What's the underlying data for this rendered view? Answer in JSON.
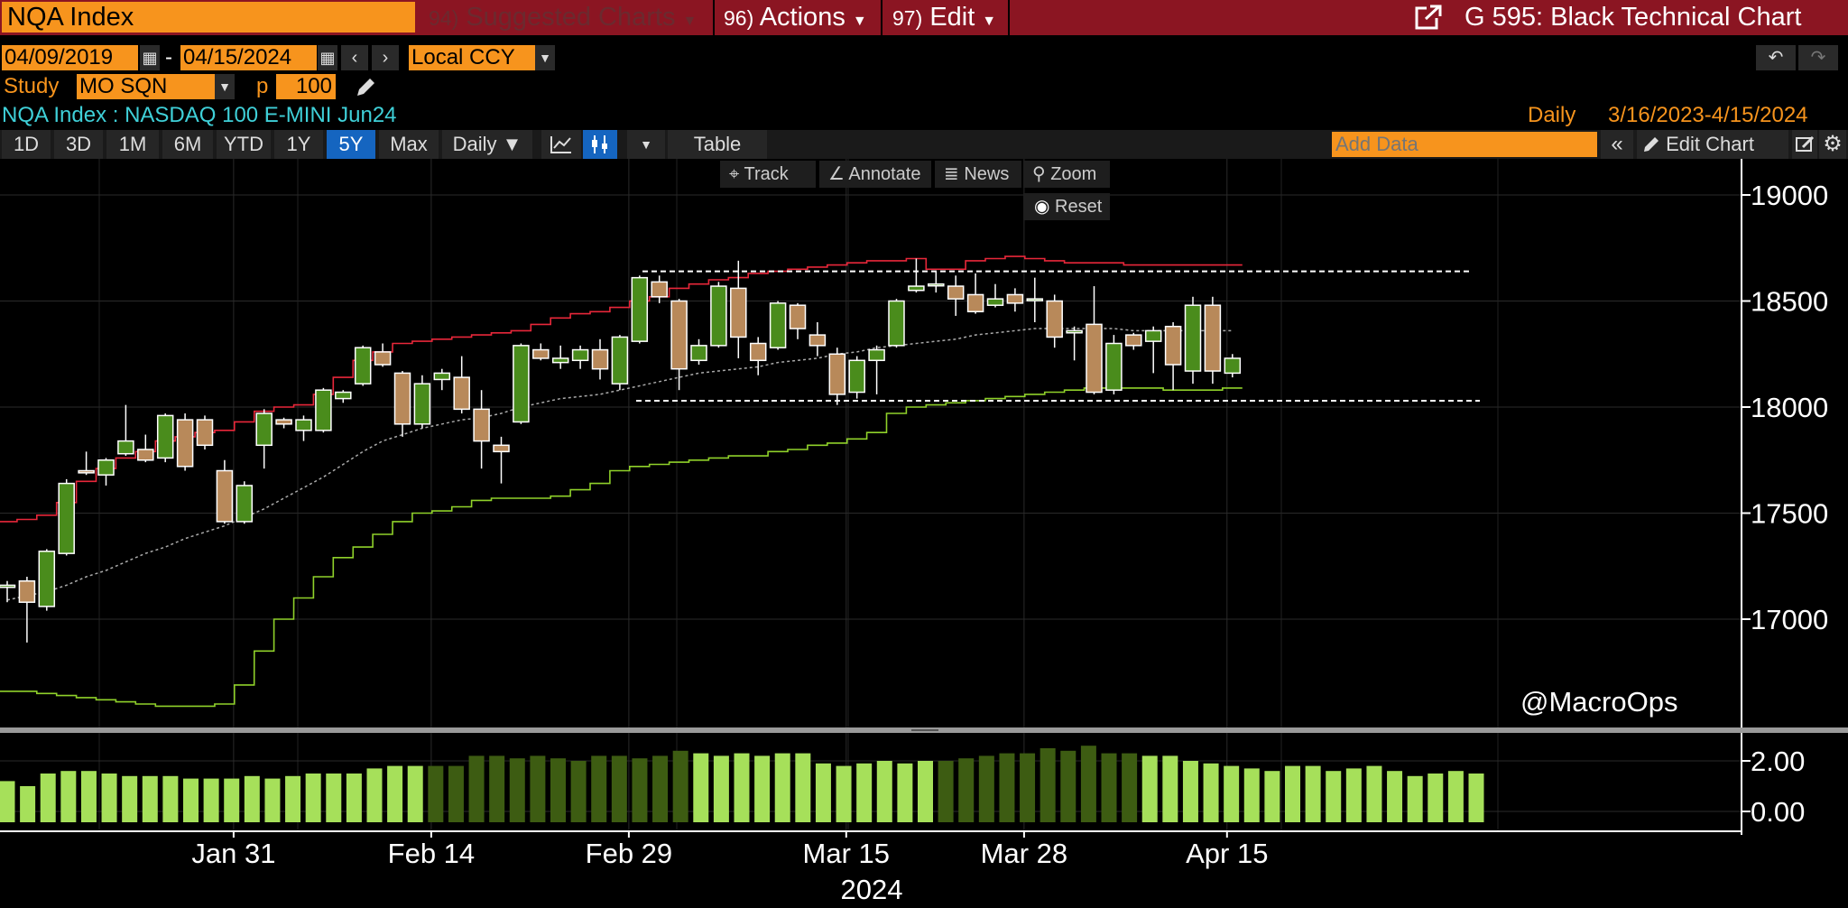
{
  "header": {
    "ticker": "NQA Index",
    "menu": [
      {
        "num": "94)",
        "label": "Suggested Charts",
        "dim": true
      },
      {
        "num": "96)",
        "label": "Actions",
        "dim": false
      },
      {
        "num": "97)",
        "label": "Edit",
        "dim": false
      }
    ],
    "chart_title": "G 595: Black Technical Chart"
  },
  "range": {
    "start": "04/09/2019",
    "dash": "-",
    "end": "04/15/2024",
    "currency": "Local CCY"
  },
  "study": {
    "label": "Study",
    "value": "MO SQN",
    "p_label": "p",
    "p_value": "100"
  },
  "security": {
    "description": "NQA Index : NASDAQ 100 E-MINI Jun24",
    "frequency": "Daily",
    "date_range": "3/16/2023-4/15/2024"
  },
  "toolbar": {
    "periods": [
      "1D",
      "3D",
      "1M",
      "6M",
      "YTD",
      "1Y",
      "5Y",
      "Max"
    ],
    "active_period": "5Y",
    "frequency": "Daily ▼",
    "table_label": "Table",
    "add_data_placeholder": "Add Data",
    "edit_chart_label": "Edit Chart"
  },
  "overlay": {
    "track": "Track",
    "annotate": "Annotate",
    "news": "News",
    "zoom": "Zoom",
    "reset": "Reset"
  },
  "watermark": "@MacroOps",
  "colors": {
    "title_bar": "#8b1522",
    "orange": "#f7941d",
    "up_candle": "#4a8c1c",
    "down_candle": "#b8895a",
    "upper_band": "#e8273a",
    "lower_band": "#8fd12a",
    "ma_line": "#aaaaaa",
    "hist_light": "#a6e05a",
    "hist_dark": "#3d5c12"
  },
  "chart_data": [
    {
      "type": "candlestick",
      "title": "NQA Index : NASDAQ 100 E-MINI Jun24",
      "x_tick_labels": [
        "Jan 31",
        "Feb 14",
        "Feb 29",
        "Mar 15",
        "Mar 28",
        "Apr 15"
      ],
      "x_year_label": "2024",
      "y_ticks": [
        17000,
        17500,
        18000,
        18500,
        19000
      ],
      "ylim": [
        16600,
        19200
      ],
      "candles": [
        {
          "o": 17150,
          "h": 17180,
          "l": 17080,
          "c": 17160
        },
        {
          "o": 17180,
          "h": 17200,
          "l": 16890,
          "c": 17080
        },
        {
          "o": 17060,
          "h": 17330,
          "l": 17040,
          "c": 17320
        },
        {
          "o": 17310,
          "h": 17660,
          "l": 17300,
          "c": 17640
        },
        {
          "o": 17700,
          "h": 17790,
          "l": 17680,
          "c": 17690
        },
        {
          "o": 17680,
          "h": 17760,
          "l": 17630,
          "c": 17750
        },
        {
          "o": 17780,
          "h": 18010,
          "l": 17770,
          "c": 17840
        },
        {
          "o": 17800,
          "h": 17870,
          "l": 17740,
          "c": 17750
        },
        {
          "o": 17760,
          "h": 17970,
          "l": 17740,
          "c": 17960
        },
        {
          "o": 17940,
          "h": 17970,
          "l": 17700,
          "c": 17720
        },
        {
          "o": 17940,
          "h": 17960,
          "l": 17800,
          "c": 17820
        },
        {
          "o": 17700,
          "h": 17750,
          "l": 17450,
          "c": 17460
        },
        {
          "o": 17460,
          "h": 17650,
          "l": 17450,
          "c": 17630
        },
        {
          "o": 17820,
          "h": 17990,
          "l": 17710,
          "c": 17970
        },
        {
          "o": 17940,
          "h": 17950,
          "l": 17900,
          "c": 17920
        },
        {
          "o": 17890,
          "h": 17960,
          "l": 17840,
          "c": 17940
        },
        {
          "o": 17890,
          "h": 18090,
          "l": 17880,
          "c": 18080
        },
        {
          "o": 18040,
          "h": 18080,
          "l": 18020,
          "c": 18070
        },
        {
          "o": 18110,
          "h": 18290,
          "l": 18100,
          "c": 18280
        },
        {
          "o": 18260,
          "h": 18300,
          "l": 18190,
          "c": 18200
        },
        {
          "o": 18160,
          "h": 18170,
          "l": 17860,
          "c": 17920
        },
        {
          "o": 17920,
          "h": 18150,
          "l": 17900,
          "c": 18110
        },
        {
          "o": 18130,
          "h": 18180,
          "l": 18080,
          "c": 18160
        },
        {
          "o": 18140,
          "h": 18240,
          "l": 17970,
          "c": 17990
        },
        {
          "o": 17990,
          "h": 18080,
          "l": 17710,
          "c": 17840
        },
        {
          "o": 17820,
          "h": 17860,
          "l": 17640,
          "c": 17790
        },
        {
          "o": 17930,
          "h": 18300,
          "l": 17920,
          "c": 18290
        },
        {
          "o": 18270,
          "h": 18300,
          "l": 18220,
          "c": 18230
        },
        {
          "o": 18210,
          "h": 18290,
          "l": 18180,
          "c": 18230
        },
        {
          "o": 18220,
          "h": 18290,
          "l": 18180,
          "c": 18270
        },
        {
          "o": 18270,
          "h": 18320,
          "l": 18130,
          "c": 18180
        },
        {
          "o": 18110,
          "h": 18340,
          "l": 18080,
          "c": 18330
        },
        {
          "o": 18310,
          "h": 18620,
          "l": 18300,
          "c": 18610
        },
        {
          "o": 18590,
          "h": 18620,
          "l": 18490,
          "c": 18520
        },
        {
          "o": 18500,
          "h": 18510,
          "l": 18080,
          "c": 18180
        },
        {
          "o": 18220,
          "h": 18320,
          "l": 18200,
          "c": 18290
        },
        {
          "o": 18290,
          "h": 18590,
          "l": 18280,
          "c": 18570
        },
        {
          "o": 18560,
          "h": 18690,
          "l": 18230,
          "c": 18330
        },
        {
          "o": 18300,
          "h": 18330,
          "l": 18150,
          "c": 18220
        },
        {
          "o": 18280,
          "h": 18500,
          "l": 18270,
          "c": 18490
        },
        {
          "o": 18480,
          "h": 18490,
          "l": 18320,
          "c": 18370
        },
        {
          "o": 18340,
          "h": 18400,
          "l": 18240,
          "c": 18290
        },
        {
          "o": 18250,
          "h": 18280,
          "l": 18010,
          "c": 18060
        },
        {
          "o": 18070,
          "h": 18240,
          "l": 18040,
          "c": 18220
        },
        {
          "o": 18220,
          "h": 18290,
          "l": 18060,
          "c": 18270
        },
        {
          "o": 18290,
          "h": 18510,
          "l": 18280,
          "c": 18500
        },
        {
          "o": 18550,
          "h": 18700,
          "l": 18540,
          "c": 18570
        },
        {
          "o": 18580,
          "h": 18640,
          "l": 18540,
          "c": 18580
        },
        {
          "o": 18570,
          "h": 18620,
          "l": 18430,
          "c": 18510
        },
        {
          "o": 18530,
          "h": 18630,
          "l": 18440,
          "c": 18450
        },
        {
          "o": 18480,
          "h": 18580,
          "l": 18470,
          "c": 18510
        },
        {
          "o": 18530,
          "h": 18560,
          "l": 18450,
          "c": 18490
        },
        {
          "o": 18510,
          "h": 18610,
          "l": 18400,
          "c": 18510
        },
        {
          "o": 18500,
          "h": 18530,
          "l": 18280,
          "c": 18330
        },
        {
          "o": 18350,
          "h": 18380,
          "l": 18220,
          "c": 18360
        },
        {
          "o": 18390,
          "h": 18570,
          "l": 18060,
          "c": 18070
        },
        {
          "o": 18080,
          "h": 18340,
          "l": 18060,
          "c": 18300
        },
        {
          "o": 18340,
          "h": 18350,
          "l": 18270,
          "c": 18290
        },
        {
          "o": 18310,
          "h": 18380,
          "l": 18160,
          "c": 18360
        },
        {
          "o": 18380,
          "h": 18400,
          "l": 18080,
          "c": 18200
        },
        {
          "o": 18170,
          "h": 18520,
          "l": 18110,
          "c": 18480
        },
        {
          "o": 18480,
          "h": 18520,
          "l": 18110,
          "c": 18170
        },
        {
          "o": 18160,
          "h": 18250,
          "l": 18140,
          "c": 18230
        }
      ],
      "upper_band": [
        17460,
        17470,
        17490,
        17550,
        17650,
        17710,
        17760,
        17790,
        17840,
        17860,
        17880,
        17890,
        17930,
        17980,
        18000,
        18010,
        18060,
        18140,
        18220,
        18260,
        18300,
        18310,
        18320,
        18330,
        18340,
        18350,
        18360,
        18390,
        18420,
        18440,
        18450,
        18470,
        18500,
        18520,
        18560,
        18580,
        18600,
        18610,
        18630,
        18640,
        18650,
        18660,
        18670,
        18680,
        18690,
        18690,
        18700,
        18650,
        18650,
        18690,
        18700,
        18710,
        18700,
        18690,
        18680,
        18680,
        18680,
        18670,
        18670,
        18670,
        18670,
        18670,
        18670
      ],
      "moving_average": [
        17090,
        17110,
        17130,
        17160,
        17200,
        17230,
        17270,
        17310,
        17340,
        17380,
        17410,
        17440,
        17480,
        17520,
        17570,
        17620,
        17670,
        17730,
        17790,
        17840,
        17870,
        17900,
        17920,
        17940,
        17950,
        17970,
        18000,
        18020,
        18040,
        18050,
        18060,
        18080,
        18100,
        18120,
        18140,
        18160,
        18170,
        18180,
        18190,
        18210,
        18220,
        18230,
        18250,
        18260,
        18280,
        18290,
        18300,
        18310,
        18320,
        18340,
        18350,
        18360,
        18370,
        18370,
        18370,
        18370,
        18370,
        18360,
        18360,
        18360,
        18360,
        18360,
        18360
      ],
      "lower_band": [
        16660,
        16660,
        16650,
        16640,
        16630,
        16620,
        16610,
        16600,
        16590,
        16590,
        16590,
        16600,
        16690,
        16850,
        17000,
        17100,
        17200,
        17290,
        17340,
        17400,
        17460,
        17500,
        17510,
        17530,
        17560,
        17570,
        17570,
        17570,
        17580,
        17610,
        17640,
        17700,
        17720,
        17730,
        17740,
        17750,
        17760,
        17770,
        17770,
        17790,
        17800,
        17820,
        17830,
        17850,
        17880,
        17970,
        18000,
        18010,
        18020,
        18030,
        18040,
        18050,
        18060,
        18070,
        18080,
        18090,
        18090,
        18090,
        18090,
        18080,
        18080,
        18080,
        18090
      ],
      "resistance_level": 18640,
      "support_level": 18030
    },
    {
      "type": "bar",
      "title": "MO SQN",
      "y_ticks": [
        0.0,
        2.0
      ],
      "y_tick_labels": [
        "0.00",
        "2.00"
      ],
      "ylim": [
        -0.4,
        2.6
      ],
      "values": [
        1.2,
        1.0,
        1.5,
        1.6,
        1.6,
        1.5,
        1.4,
        1.4,
        1.4,
        1.3,
        1.3,
        1.3,
        1.4,
        1.3,
        1.4,
        1.5,
        1.5,
        1.5,
        1.7,
        1.8,
        1.8,
        1.8,
        1.8,
        2.2,
        2.2,
        2.1,
        2.2,
        2.1,
        2.0,
        2.2,
        2.2,
        2.1,
        2.2,
        2.4,
        2.3,
        2.2,
        2.3,
        2.2,
        2.3,
        2.3,
        1.9,
        1.8,
        1.9,
        2.0,
        1.9,
        2.0,
        2.0,
        2.1,
        2.2,
        2.3,
        2.3,
        2.5,
        2.4,
        2.6,
        2.3,
        2.3,
        2.2,
        2.2,
        2.0,
        1.9,
        1.8,
        1.7,
        1.6,
        1.8,
        1.8,
        1.6,
        1.7,
        1.8,
        1.6,
        1.4,
        1.5,
        1.6,
        1.5
      ]
    }
  ]
}
